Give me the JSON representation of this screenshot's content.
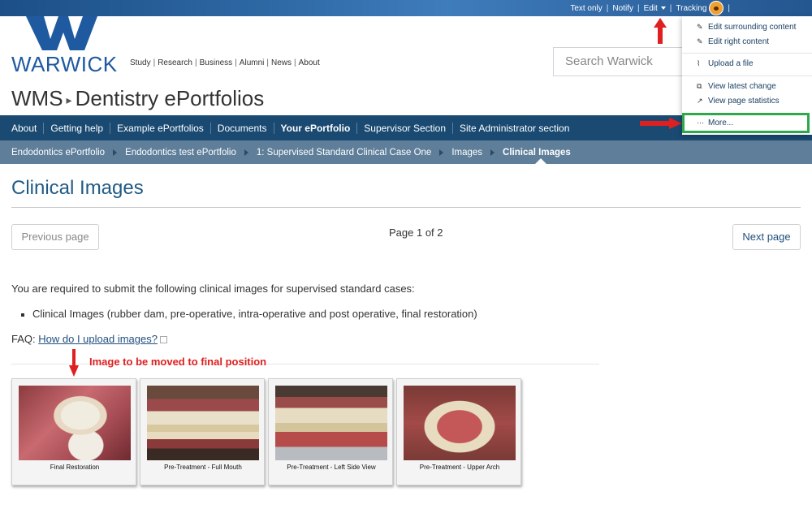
{
  "utility": {
    "links": [
      "Text only",
      "Notify",
      "Edit",
      "Tracking"
    ]
  },
  "logo": {
    "wordmark": "WARWICK"
  },
  "topnav": {
    "items": [
      "Study",
      "Research",
      "Business",
      "Alumni",
      "News",
      "About"
    ]
  },
  "search": {
    "placeholder": "Search Warwick"
  },
  "site": {
    "title_part1": "WMS",
    "title_part2": "Dentistry ePortfolios"
  },
  "mainnav": {
    "items": [
      "About",
      "Getting help",
      "Example ePortfolios",
      "Documents",
      "Your ePortfolio",
      "Supervisor Section",
      "Site Administrator section"
    ],
    "active": "Your ePortfolio"
  },
  "breadcrumb": {
    "items": [
      "Endodontics ePortfolio",
      "Endodontics test ePortfolio",
      "1: Supervised Standard Clinical Case One",
      "Images",
      "Clinical Images"
    ]
  },
  "page": {
    "title": "Clinical Images",
    "prev_label": "Previous page",
    "next_label": "Next page",
    "page_indicator": "Page 1 of 2",
    "intro": "You are required to submit the following clinical images for supervised standard cases:",
    "bullet": "Clinical Images (rubber dam, pre-operative, intra-operative and post operative, final restoration)",
    "faq_prefix": "FAQ:",
    "faq_link": "How do I upload images?"
  },
  "annotation": {
    "text": "Image to be moved to final position",
    "color": "#e02020"
  },
  "gallery": [
    {
      "caption": "Final Restoration"
    },
    {
      "caption": "Pre-Treatment - Full Mouth"
    },
    {
      "caption": "Pre-Treatment - Left Side View"
    },
    {
      "caption": "Pre-Treatment - Upper Arch"
    }
  ],
  "edit_menu": {
    "items": [
      "Edit surrounding content",
      "Edit right content",
      "Upload a file",
      "View latest change",
      "View page statistics",
      "More..."
    ],
    "icons": [
      "pencil-icon",
      "pencil-icon",
      "paperclip-icon",
      "history-icon",
      "chart-icon",
      "ellipsis-icon"
    ]
  },
  "colors": {
    "nav": "#1a4a72",
    "breadcrumb": "#5e7e99",
    "highlight": "#2ea84a",
    "brand": "#1f5aa0"
  }
}
